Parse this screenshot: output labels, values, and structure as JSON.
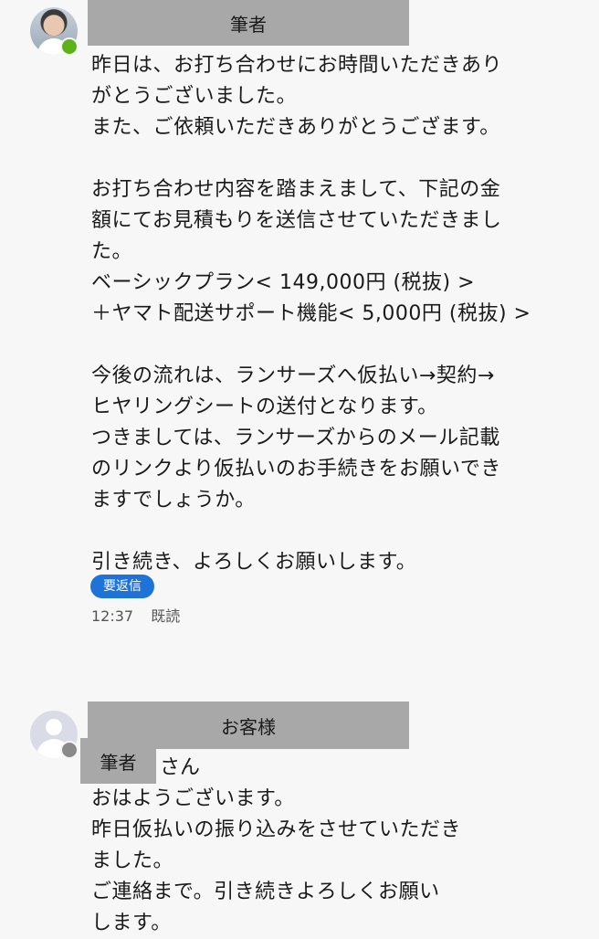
{
  "messages": [
    {
      "sender": "筆者",
      "avatar": "person-photo-avatar",
      "status_color": "#5bb319",
      "body": "昨日は、お打ち合わせにお時間いただきあり\nがとうございました。\nまた、ご依頼いただきありがとうござます。\n\nお打ち合わせ内容を踏まえまして、下記の金\n額にてお見積もりを送信させていただきまし\nた。\nベーシックプラン< 149,000円 (税抜) >\n＋ヤマト配送サポート機能< 5,000円 (税抜) >\n\n今後の流れは、ランサーズへ仮払い→契約→\nヒヤリングシートの送付となります。\nつきましては、ランサーズからのメール記載\nのリンクより仮払いのお手続きをお願いでき\nますでしょうか。\n\n引き続き、よろしくお願いします。",
      "badge": "要返信",
      "time": "12:37",
      "read_status": "既読"
    },
    {
      "sender": "お客様",
      "avatar": "default-user-avatar",
      "status_color": "#8a8a8a",
      "addressee": "筆者",
      "salutation": "さん",
      "body": "おはようございます。\n昨日仮払いの振り込みをさせていただき\nました。\nご連絡まで。引き続きよろしくお願い\nします。"
    }
  ]
}
